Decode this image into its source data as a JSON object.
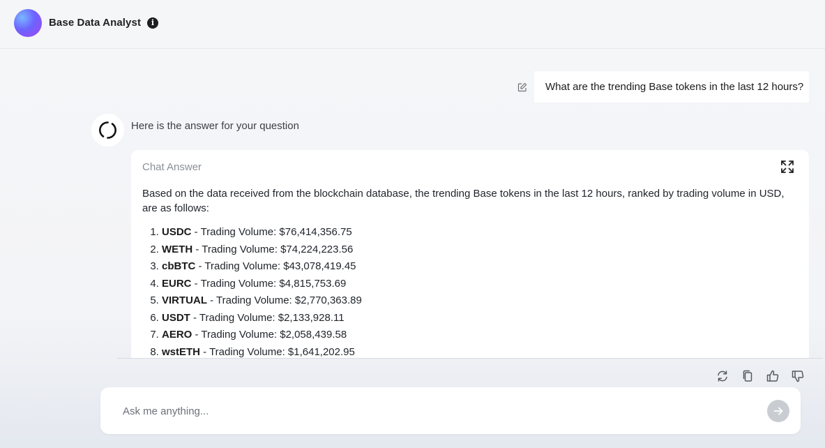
{
  "header": {
    "title": "Base Data Analyst",
    "info_icon": "info-icon"
  },
  "user_message": {
    "text": "What are the trending Base tokens in the last 12 hours?",
    "edit_icon": "edit-icon"
  },
  "assistant": {
    "intro": "Here is the answer for your question",
    "card_label": "Chat Answer",
    "answer_intro": "Based on the data received from the blockchain database, the trending Base tokens in the last 12 hours, ranked by trading volume in USD, are as follows:",
    "tokens": [
      {
        "symbol": "USDC",
        "text": " - Trading Volume: $76,414,356.75"
      },
      {
        "symbol": "WETH",
        "text": " - Trading Volume: $74,224,223.56"
      },
      {
        "symbol": "cbBTC",
        "text": " - Trading Volume: $43,078,419.45"
      },
      {
        "symbol": "EURC",
        "text": " - Trading Volume: $4,815,753.69"
      },
      {
        "symbol": "VIRTUAL",
        "text": " - Trading Volume: $2,770,363.89"
      },
      {
        "symbol": "USDT",
        "text": " - Trading Volume: $2,133,928.11"
      },
      {
        "symbol": "AERO",
        "text": " - Trading Volume: $2,058,439.58"
      },
      {
        "symbol": "wstETH",
        "text": " - Trading Volume: $1,641,202.95"
      }
    ]
  },
  "actions": [
    "regenerate-icon",
    "copy-icon",
    "thumbs-up-icon",
    "thumbs-down-icon"
  ],
  "input": {
    "placeholder": "Ask me anything...",
    "value": ""
  },
  "colors": {
    "background": "#f4f5f7",
    "card": "#ffffff",
    "muted_text": "#8a8f96",
    "send_button": "#c9ccd1",
    "logo_gradient": [
      "#7ab8ff",
      "#6c63ff",
      "#a246f0"
    ]
  }
}
